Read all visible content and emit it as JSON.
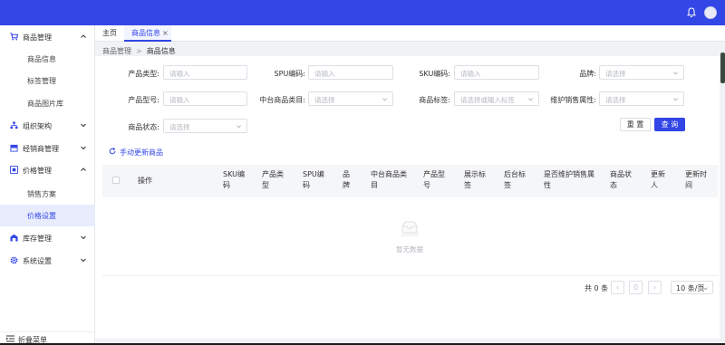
{
  "header": {
    "bell_icon": "bell-icon",
    "avatar": "user-avatar"
  },
  "sidebar": {
    "groups": [
      {
        "label": "商品管理",
        "icon": "cart-icon",
        "expanded": true
      },
      {
        "label": "组织架构",
        "icon": "org-chart-icon",
        "expanded": false
      },
      {
        "label": "经销商管理",
        "icon": "dealer-icon",
        "expanded": false
      },
      {
        "label": "价格管理",
        "icon": "price-icon",
        "expanded": true
      },
      {
        "label": "库存管理",
        "icon": "warehouse-icon",
        "expanded": false
      },
      {
        "label": "系统设置",
        "icon": "gear-icon",
        "expanded": false
      }
    ],
    "product_items": [
      "商品信息",
      "标签管理",
      "商品图片库"
    ],
    "price_items": [
      "销售方案",
      "价格设置"
    ],
    "active_item": "价格设置",
    "fold_label": "折叠菜单",
    "accent": "#3346e6"
  },
  "tabs": {
    "home": "主页",
    "current": "商品信息",
    "close_icon": "close-icon"
  },
  "breadcrumb": {
    "parent": "商品管理",
    "separator": ">",
    "current": "商品信息"
  },
  "filters": {
    "product_type": {
      "label": "产品类型:",
      "placeholder": "请输入"
    },
    "spu_code": {
      "label": "SPU编码:",
      "placeholder": "请输入"
    },
    "sku_code": {
      "label": "SKU编码:",
      "placeholder": "请输入"
    },
    "brand": {
      "label": "品牌:",
      "placeholder": "请选择"
    },
    "product_model": {
      "label": "产品型号:",
      "placeholder": "请输入"
    },
    "platform_category": {
      "label": "中台商品类目:",
      "placeholder": "请选择"
    },
    "product_tag": {
      "label": "商品标签:",
      "placeholder": "请选择或输入标签"
    },
    "sale_attr": {
      "label": "维护销售属性:",
      "placeholder": "请选择"
    },
    "product_status": {
      "label": "商品状态:",
      "placeholder": "请选择"
    }
  },
  "buttons": {
    "reset": "重 置",
    "query": "查 询"
  },
  "refresh_link": "手动更新商品",
  "table": {
    "columns": [
      "操作",
      "SKU编码",
      "产品类型",
      "SPU编码",
      "品牌",
      "中台商品类目",
      "产品型号",
      "展示标签",
      "后台标签",
      "是否维护销售属性",
      "商品状态",
      "更新人",
      "更新时间"
    ],
    "column_display": [
      [
        "操作"
      ],
      [
        "SKU编",
        "码"
      ],
      [
        "产品类",
        "型"
      ],
      [
        "SPU编",
        "码"
      ],
      [
        "品",
        "牌"
      ],
      [
        "中台商品类",
        "目"
      ],
      [
        "产品型",
        "号"
      ],
      [
        "展示标",
        "签"
      ],
      [
        "后台标",
        "签"
      ],
      [
        "是否维护销售属",
        "性"
      ],
      [
        "商品状",
        "态"
      ],
      [
        "更新",
        "人"
      ],
      [
        "更新时",
        "间"
      ]
    ],
    "empty_text": "暂无数据",
    "rows": []
  },
  "pagination": {
    "total_text": "共 0 条",
    "current_page": "0",
    "page_size": "10 条/页"
  }
}
